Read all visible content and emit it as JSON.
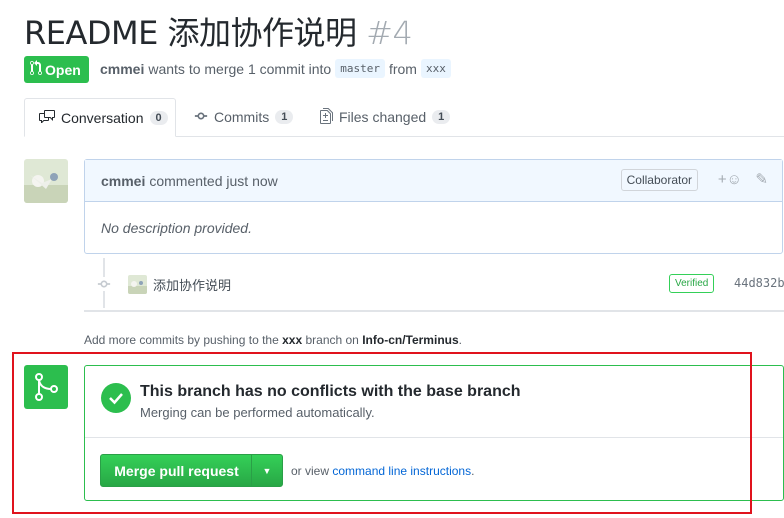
{
  "header": {
    "title": "README 添加协作说明",
    "number": "#4"
  },
  "state": {
    "label": "Open",
    "icon": "git-pull-request-icon"
  },
  "meta": {
    "author": "cmmei",
    "text_before_count": "wants to merge 1 commit into",
    "base_branch": "master",
    "from_text": "from",
    "head_branch": "xxx"
  },
  "tabs": [
    {
      "label": "Conversation",
      "count": "0",
      "icon": "comment-discussion-icon"
    },
    {
      "label": "Commits",
      "count": "1",
      "icon": "git-commit-icon"
    },
    {
      "label": "Files changed",
      "count": "1",
      "icon": "file-diff-icon"
    }
  ],
  "comment": {
    "author": "cmmei",
    "action": "commented just now",
    "role_badge": "Collaborator",
    "body": "No description provided."
  },
  "commit": {
    "message": "添加协作说明",
    "verified": "Verified",
    "sha": "44d832b"
  },
  "add_note": {
    "prefix": "Add more commits by pushing to the",
    "branch": "xxx",
    "middle": "branch on",
    "repo": "Info-cn/Terminus",
    "suffix": "."
  },
  "merge": {
    "title": "This branch has no conflicts with the base branch",
    "subtitle": "Merging can be performed automatically.",
    "button": "Merge pull request",
    "or_view": "or view",
    "link": "command line instructions",
    "after": "."
  },
  "colors": {
    "green": "#2cbe4e",
    "link": "#0366d6",
    "highlight": "#e0131d"
  }
}
